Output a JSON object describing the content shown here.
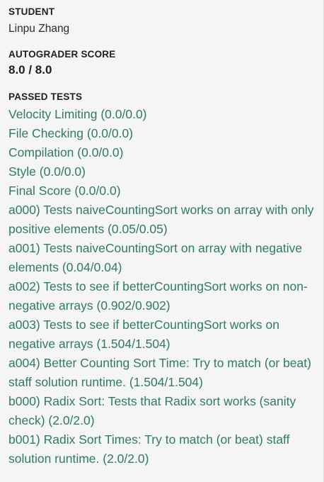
{
  "student": {
    "label": "STUDENT",
    "name": "Linpu Zhang"
  },
  "autograder": {
    "label": "AUTOGRADER SCORE",
    "score": "8.0 / 8.0"
  },
  "passed_tests": {
    "label": "PASSED TESTS",
    "items": [
      "Velocity Limiting (0.0/0.0)",
      "File Checking (0.0/0.0)",
      "Compilation (0.0/0.0)",
      "Style (0.0/0.0)",
      "Final Score (0.0/0.0)",
      "a000) Tests naiveCountingSort works on array with only positive elements (0.05/0.05)",
      "a001) Tests naiveCountingSort on array with negative elements (0.04/0.04)",
      "a002) Tests to see if betterCountingSort works on non-negative arrays (0.902/0.902)",
      "a003) Tests to see if betterCountingSort works on negative arrays (1.504/1.504)",
      "a004) Better Counting Sort Time: Try to match (or beat) staff solution runtime. (1.504/1.504)",
      "b000) Radix Sort: Tests that Radix sort works (sanity check) (2.0/2.0)",
      "b001) Radix Sort Times: Try to match (or beat) staff solution runtime. (2.0/2.0)"
    ]
  },
  "colors": {
    "passed_text": "#2e7d5b",
    "background": "#f5f5f5"
  }
}
